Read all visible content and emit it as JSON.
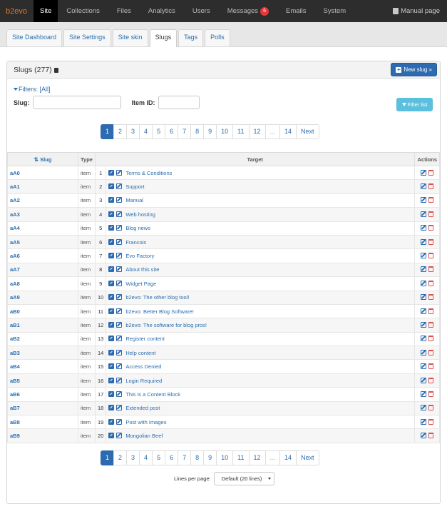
{
  "topnav": {
    "brand": "b2evo",
    "items": [
      {
        "label": "Site",
        "active": true
      },
      {
        "label": "Collections"
      },
      {
        "label": "Files"
      },
      {
        "label": "Analytics"
      },
      {
        "label": "Users"
      },
      {
        "label": "Messages",
        "badge": "6"
      },
      {
        "label": "Emails"
      },
      {
        "label": "System"
      }
    ],
    "manual_label": "Manual page"
  },
  "subtabs": [
    {
      "label": "Site Dashboard"
    },
    {
      "label": "Site Settings"
    },
    {
      "label": "Site skin"
    },
    {
      "label": "Slugs",
      "active": true
    },
    {
      "label": "Tags"
    },
    {
      "label": "Polls"
    }
  ],
  "panel": {
    "title": "Slugs (277)",
    "new_button": "New slug »"
  },
  "filters": {
    "toggle_label": "Filters:",
    "all_label": "[All]",
    "slug_label": "Slug:",
    "slug_value": "",
    "item_id_label": "Item ID:",
    "item_id_value": "",
    "button_label": "Filter list"
  },
  "pagination": [
    "1",
    "2",
    "3",
    "4",
    "5",
    "6",
    "7",
    "8",
    "9",
    "10",
    "11",
    "12",
    "...",
    "14",
    "Next"
  ],
  "pagination_active": "1",
  "table": {
    "headers": {
      "slug": "Slug",
      "type": "Type",
      "target": "Target",
      "actions": "Actions"
    },
    "rows": [
      {
        "slug": "aA0",
        "type": "item",
        "num": "1",
        "title": "Terms & Conditions"
      },
      {
        "slug": "aA1",
        "type": "item",
        "num": "2",
        "title": "Support"
      },
      {
        "slug": "aA2",
        "type": "item",
        "num": "3",
        "title": "Manual"
      },
      {
        "slug": "aA3",
        "type": "item",
        "num": "4",
        "title": "Web hosting"
      },
      {
        "slug": "aA4",
        "type": "item",
        "num": "5",
        "title": "Blog news"
      },
      {
        "slug": "aA5",
        "type": "item",
        "num": "6",
        "title": "Francois"
      },
      {
        "slug": "aA6",
        "type": "item",
        "num": "7",
        "title": "Evo Factory"
      },
      {
        "slug": "aA7",
        "type": "item",
        "num": "8",
        "title": "About this site"
      },
      {
        "slug": "aA8",
        "type": "item",
        "num": "9",
        "title": "Widget Page"
      },
      {
        "slug": "aA9",
        "type": "item",
        "num": "10",
        "title": "b2evo: The other blog tool!"
      },
      {
        "slug": "aB0",
        "type": "item",
        "num": "11",
        "title": "b2evo: Better Blog Software!"
      },
      {
        "slug": "aB1",
        "type": "item",
        "num": "12",
        "title": "b2evo: The software for blog pros!"
      },
      {
        "slug": "aB2",
        "type": "item",
        "num": "13",
        "title": "Register content"
      },
      {
        "slug": "aB3",
        "type": "item",
        "num": "14",
        "title": "Help content"
      },
      {
        "slug": "aB4",
        "type": "item",
        "num": "15",
        "title": "Access Denied"
      },
      {
        "slug": "aB5",
        "type": "item",
        "num": "16",
        "title": "Login Required"
      },
      {
        "slug": "aB6",
        "type": "item",
        "num": "17",
        "title": "This is a Content Block"
      },
      {
        "slug": "aB7",
        "type": "item",
        "num": "18",
        "title": "Extended post"
      },
      {
        "slug": "aB8",
        "type": "item",
        "num": "19",
        "title": "Post with Images"
      },
      {
        "slug": "aB9",
        "type": "item",
        "num": "20",
        "title": "Mongolian Beef"
      }
    ]
  },
  "lines_per_page": {
    "label": "Lines per page:",
    "value": "Default (20 lines)"
  },
  "colors": {
    "brand": "#e8732a",
    "primary": "#2d6ab0",
    "info": "#5bc0de",
    "danger": "#d9534f",
    "badge": "#e2383a"
  }
}
